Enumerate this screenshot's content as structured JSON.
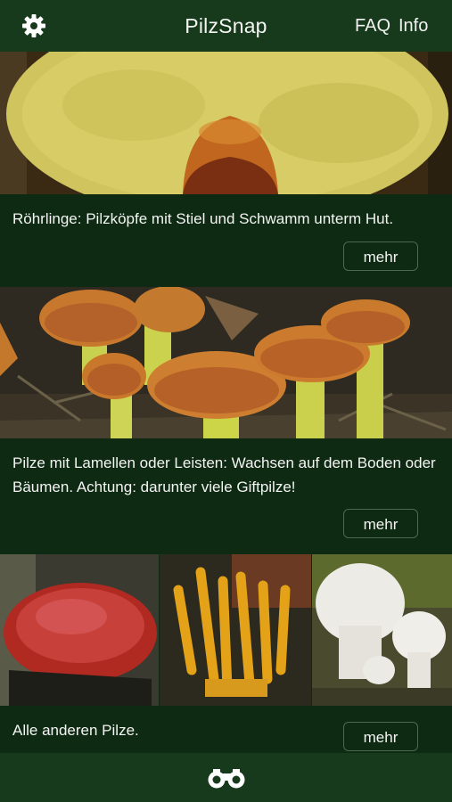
{
  "header": {
    "settings_icon": "gear-icon",
    "title": "PilzSnap",
    "faq_label": "FAQ",
    "info_label": "Info"
  },
  "sections": [
    {
      "caption": "Röhrlinge: Pilzköpfe mit Stiel und Schwamm unterm Hut.",
      "button_label": "mehr"
    },
    {
      "caption": "Pilze mit Lamellen oder Leisten: Wachsen auf dem Boden oder Bäumen. Achtung: darunter viele Giftpilze!",
      "button_label": "mehr"
    },
    {
      "caption": "Alle anderen Pilze.",
      "button_label": "mehr"
    }
  ],
  "footer": {
    "search_icon": "binoculars-icon"
  },
  "colors": {
    "background": "#0e2a12",
    "bar": "#163a1b",
    "text": "#f4f4f4"
  }
}
